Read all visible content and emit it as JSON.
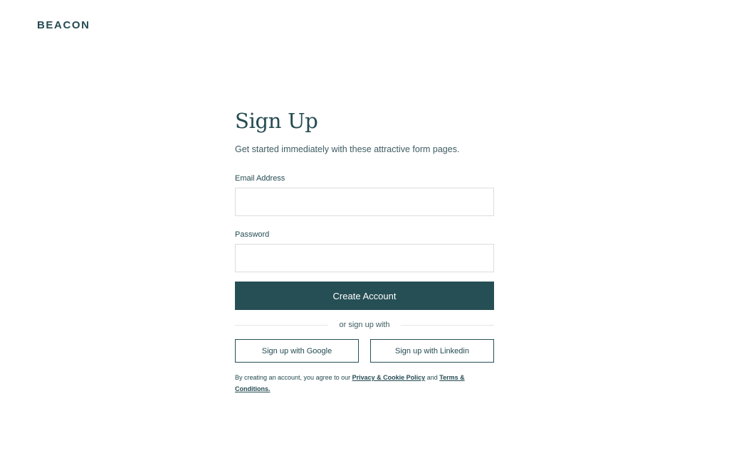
{
  "brand": {
    "name": "BEACON"
  },
  "signup": {
    "title": "Sign Up",
    "subtitle": "Get started immediately with these attractive form pages.",
    "email_label": "Email Address",
    "email_value": "",
    "password_label": "Password",
    "password_value": "",
    "submit_label": "Create Account",
    "divider_text": "or sign up with",
    "google_label": "Sign up with Google",
    "linkedin_label": "Sign up with Linkedin",
    "legal": {
      "prefix": "By creating an account, you agree to our",
      "privacy_link": "Privacy & Cookie Policy",
      "conjunction": "and",
      "terms_link": "Terms & Conditions."
    }
  },
  "colors": {
    "primary": "#264f55",
    "text": "#254b52",
    "input_border": "#dcdcdc",
    "background": "#ffffff"
  }
}
